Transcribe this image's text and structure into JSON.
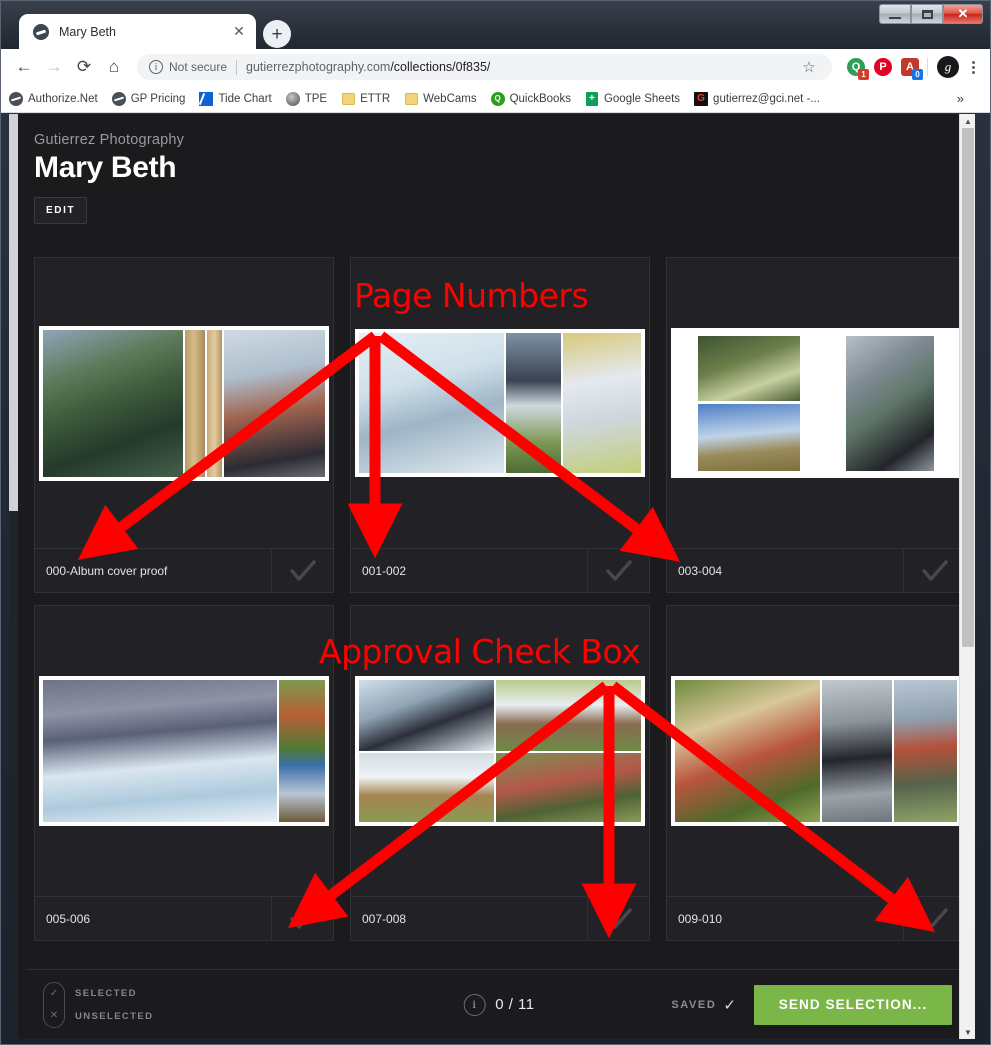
{
  "window": {
    "minimize_label": "Minimize",
    "maximize_label": "Maximize",
    "close_label": "✕"
  },
  "tab": {
    "title": "Mary Beth",
    "favicon": "globe-icon",
    "close_label": "✕",
    "new_tab_label": "+"
  },
  "toolbar": {
    "back": "←",
    "forward": "→",
    "reload": "⟳",
    "home": "⌂",
    "security_text": "Not secure",
    "url_host": "gutierrezphotography.com",
    "url_path": "/collections/0f835/",
    "star": "☆",
    "menu": "kebab-menu-icon",
    "extensions": [
      {
        "name": "hubspot-extension",
        "letter": "Q",
        "color": "#2e9e5b",
        "badge": "1",
        "badge_color": "#d63b26"
      },
      {
        "name": "pinterest-extension",
        "letter": "P",
        "color": "#e60023",
        "badge": "",
        "badge_color": ""
      },
      {
        "name": "adblock-extension",
        "letter": "A",
        "color": "#c0392b",
        "badge": "0",
        "badge_color": "#1a73e8"
      }
    ],
    "avatar_letter": "g"
  },
  "bookmarks": {
    "items": [
      {
        "label": "Authorize.Net",
        "icon": "globe-icon"
      },
      {
        "label": "GP Pricing",
        "icon": "globe-icon"
      },
      {
        "label": "Tide Chart",
        "icon": "tide-icon"
      },
      {
        "label": "TPE",
        "icon": "tpe-icon"
      },
      {
        "label": "ETTR",
        "icon": "folder-icon"
      },
      {
        "label": "WebCams",
        "icon": "folder-icon"
      },
      {
        "label": "QuickBooks",
        "icon": "quickbooks-icon"
      },
      {
        "label": "Google Sheets",
        "icon": "sheets-icon"
      },
      {
        "label": "gutierrez@gci.net -...",
        "icon": "gci-icon"
      }
    ],
    "overflow_label": "»"
  },
  "page": {
    "studio": "Gutierrez Photography",
    "client_name": "Mary Beth",
    "edit_label": "EDIT"
  },
  "gallery": {
    "rows": [
      [
        {
          "label": "000-Album cover proof",
          "checked": false
        },
        {
          "label": "001-002",
          "checked": false
        },
        {
          "label": "003-004",
          "checked": false
        }
      ],
      [
        {
          "label": "005-006",
          "checked": false
        },
        {
          "label": "007-008",
          "checked": false
        },
        {
          "label": "009-010",
          "checked": false
        }
      ]
    ]
  },
  "annotations": {
    "color": "#ff0000",
    "items": [
      {
        "text": "Page Numbers",
        "target": "page-number-labels"
      },
      {
        "text": "Approval Check Box",
        "target": "approval-checkboxes"
      }
    ]
  },
  "actionbar": {
    "legend_selected": "SELECTED",
    "legend_unselected": "UNSELECTED",
    "selected_glyph": "✓",
    "unselected_glyph": "✕",
    "info_glyph": "i",
    "count": "0 / 11",
    "saved_label": "SAVED",
    "saved_glyph": "✓",
    "send_label": "SEND SELECTION...",
    "send_color": "#7ab648"
  }
}
